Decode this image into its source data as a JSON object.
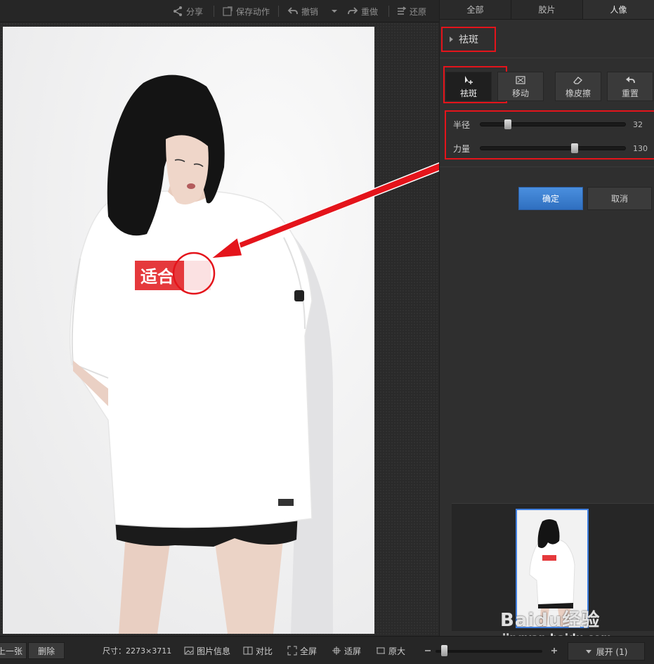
{
  "toolbar": {
    "share": "分享",
    "save_action": "保存动作",
    "undo": "撤销",
    "redo": "重做",
    "restore": "还原"
  },
  "panel": {
    "tabs": [
      "全部",
      "胶片",
      "人像"
    ],
    "active_tab": "人像",
    "section_title": "祛斑",
    "tools": [
      {
        "label": "祛斑",
        "icon": "cursor-plus-icon"
      },
      {
        "label": "移动",
        "icon": "move-frame-icon"
      },
      {
        "label": "橡皮擦",
        "icon": "eraser-icon"
      },
      {
        "label": "重置",
        "icon": "reset-arrow-icon"
      }
    ],
    "selected_tool": "祛斑",
    "sliders": [
      {
        "label": "半径",
        "value": "32",
        "fraction": 0.17
      },
      {
        "label": "力量",
        "value": "130",
        "fraction": 0.65
      }
    ],
    "ok_label": "确定",
    "cancel_label": "取消"
  },
  "photo": {
    "shirt_logo_text": "适合"
  },
  "bottombar": {
    "prev_label": "上一张",
    "delete_label": "删除",
    "size_label": "尺寸：2273×3711",
    "info_label": "图片信息",
    "compare_label": "对比",
    "fullscreen_label": "全屏",
    "fit_label": "适屏",
    "original_label": "原大",
    "expand_label": "展开 (1)",
    "zoom_fraction": 0.05
  },
  "watermark": {
    "brand": "Baidu经验",
    "url": "jingyan.baidu.com"
  },
  "colors": {
    "highlight_red": "#e4141b",
    "primary_blue": "#3a7fd5",
    "panel_bg": "#2f2f2f"
  }
}
